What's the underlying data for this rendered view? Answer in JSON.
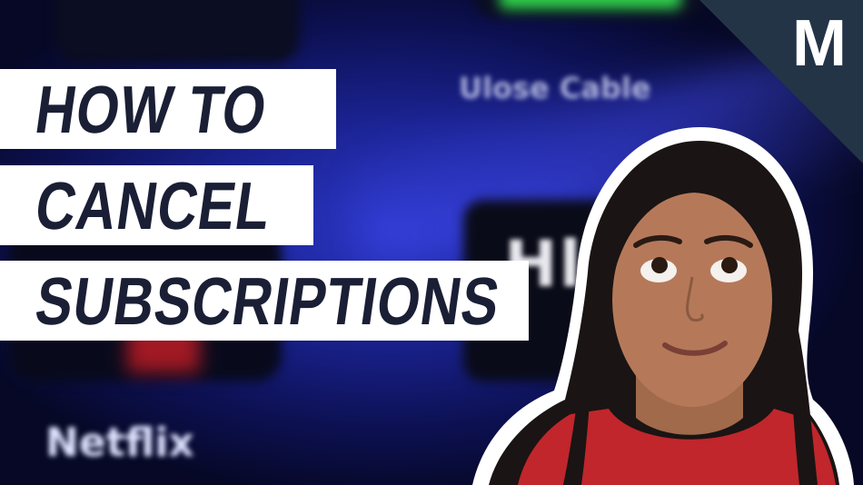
{
  "headline": {
    "line1": "HOW TO",
    "line2": "CANCEL",
    "line3": "SUBSCRIPTIONS"
  },
  "brand": {
    "logo_letter": "M",
    "corner_color": "#243447"
  },
  "background": {
    "app_label_1": "Netflix",
    "app_label_2": "Ulose Cable",
    "app_tile_letters": "Hl"
  },
  "colors": {
    "headline_bg": "#ffffff",
    "headline_text": "#1b1f35",
    "screen_blue": "#2a35c4"
  }
}
